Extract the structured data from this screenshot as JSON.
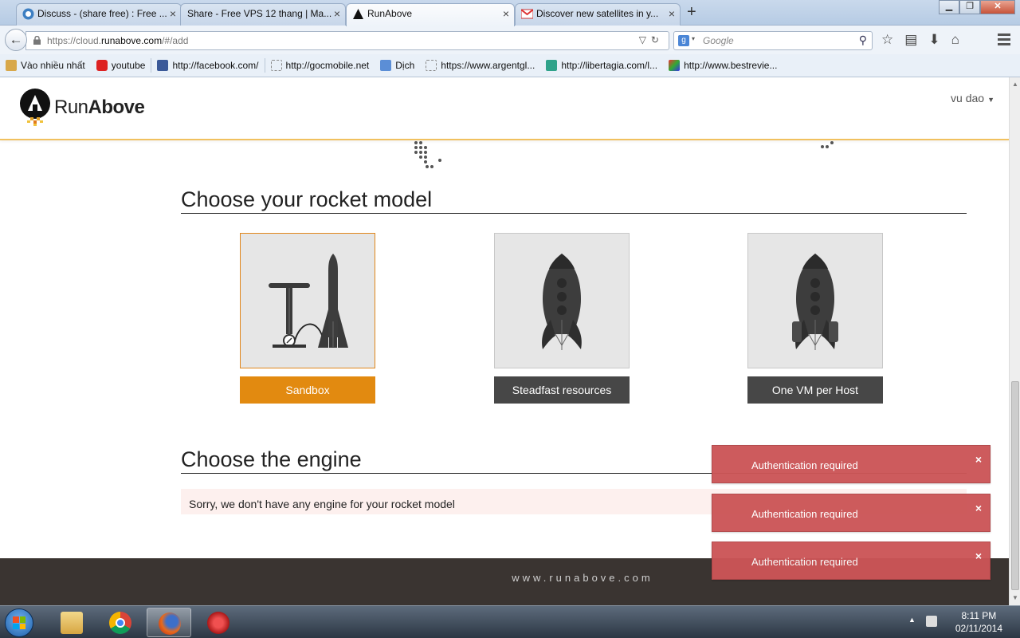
{
  "browser": {
    "tabs": [
      {
        "title": "Discuss - (share free) : Free ...",
        "active": false
      },
      {
        "title": "Share - Free VPS 12 thang | Ma...",
        "active": false
      },
      {
        "title": "RunAbove",
        "active": true
      },
      {
        "title": "Discover new satellites in y...",
        "active": false
      }
    ],
    "new_tab": "+",
    "url_prefix": "https://cloud.",
    "url_domain": "runabove.com",
    "url_suffix": "/#/add",
    "search_placeholder": "Google",
    "bookmarks": [
      {
        "label": "Vào nhiều nhất",
        "icon": "most-visited-icon"
      },
      {
        "label": "youtube",
        "icon": "youtube-icon"
      },
      {
        "label": "http://facebook.com/",
        "icon": "facebook-icon"
      },
      {
        "label": "http://gocmobile.net",
        "icon": "blank-page-icon"
      },
      {
        "label": "Dịch",
        "icon": "translate-icon"
      },
      {
        "label": "https://www.argentgl...",
        "icon": "blank-page-icon"
      },
      {
        "label": "http://libertagia.com/l...",
        "icon": "libertagia-icon"
      },
      {
        "label": "http://www.bestrevie...",
        "icon": "colorful-cube-icon"
      }
    ]
  },
  "site": {
    "logo_light": "Run",
    "logo_bold": "Above",
    "user_name": "vu dao",
    "section_rocket_title": "Choose your rocket model",
    "rockets": [
      {
        "label": "Sandbox",
        "selected": true,
        "icon": "sandbox-pump-rocket-icon"
      },
      {
        "label": "Steadfast resources",
        "selected": false,
        "icon": "rocket-icon"
      },
      {
        "label": "One VM per Host",
        "selected": false,
        "icon": "rocket-boosters-icon"
      }
    ],
    "section_engine_title": "Choose the engine",
    "engine_message": "Sorry, we don't have any engine for your rocket model",
    "footer_text": "www.runabove.com",
    "notifications": [
      {
        "message": "Authentication required",
        "close": "×"
      },
      {
        "message": "Authentication required",
        "close": "×"
      },
      {
        "message": "Authentication required",
        "close": "×"
      }
    ],
    "colors": {
      "accent": "#e28a10",
      "header_border": "#f1c15f",
      "notification": "#cc5557",
      "dark_button": "#474747",
      "footer": "#3a3431"
    }
  },
  "taskbar": {
    "time": "8:11 PM",
    "date": "02/11/2014",
    "apps": [
      "windows-explorer-icon",
      "chrome-icon",
      "firefox-icon",
      "red-app-icon"
    ]
  }
}
